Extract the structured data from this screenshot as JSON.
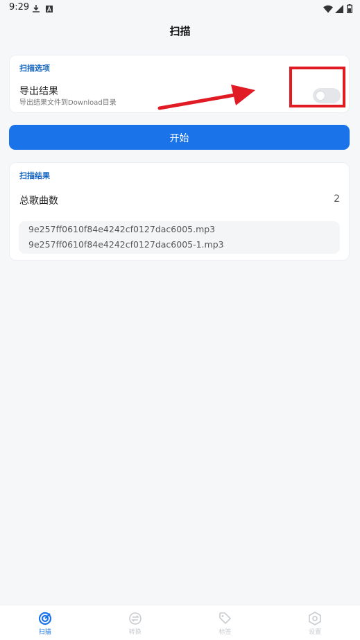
{
  "status_bar": {
    "time": "9:29"
  },
  "app_bar": {
    "title": "扫描"
  },
  "scan_options": {
    "section_title": "扫描选项",
    "export": {
      "title": "导出结果",
      "subtitle": "导出结果文件到Download目录",
      "enabled": false
    }
  },
  "start_button": {
    "label": "开始"
  },
  "scan_results": {
    "section_title": "扫描结果",
    "total_label": "总歌曲数",
    "total_value": "2",
    "files": [
      "9e257ff0610f84e4242cf0127dac6005.mp3",
      "9e257ff0610f84e4242cf0127dac6005-1.mp3"
    ]
  },
  "bottom_nav": {
    "items": [
      {
        "label": "扫描",
        "icon": "scan-icon",
        "active": true
      },
      {
        "label": "转换",
        "icon": "convert-icon",
        "active": false
      },
      {
        "label": "标签",
        "icon": "tag-icon",
        "active": false
      },
      {
        "label": "设置",
        "icon": "settings-icon",
        "active": false
      }
    ]
  },
  "colors": {
    "accent": "#1a73e8",
    "annotation": "#e01b24"
  }
}
